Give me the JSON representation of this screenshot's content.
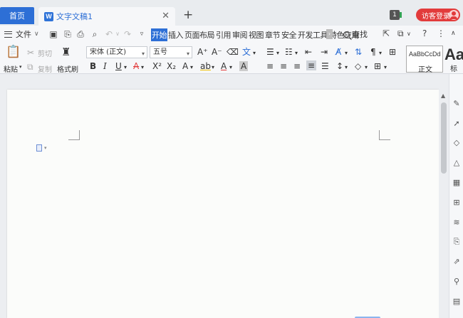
{
  "titlebar": {
    "home_tab": "首页",
    "doc_tab": "文字文稿1",
    "doc_icon": "W",
    "close": "✕",
    "add": "+",
    "badge": "1",
    "login": "访客登录"
  },
  "menubar": {
    "file": "文件",
    "tabs": [
      "开始",
      "插入",
      "页面布局",
      "引用",
      "审阅",
      "视图",
      "章节",
      "安全",
      "开发工具",
      "特色应用"
    ],
    "active_tab": "开始",
    "search": "查找"
  },
  "ribbon": {
    "paste": "粘贴",
    "cut": "剪切",
    "copy": "复制",
    "format_painter": "格式刷",
    "font": "宋体 (正文)",
    "size": "五号",
    "styles": [
      {
        "sample": "AaBbCcDd",
        "name": "正文"
      },
      {
        "sample": "Aa",
        "name": "标"
      }
    ]
  },
  "colors": {
    "accent": "#2d6fd6",
    "login": "#e23b3b"
  }
}
